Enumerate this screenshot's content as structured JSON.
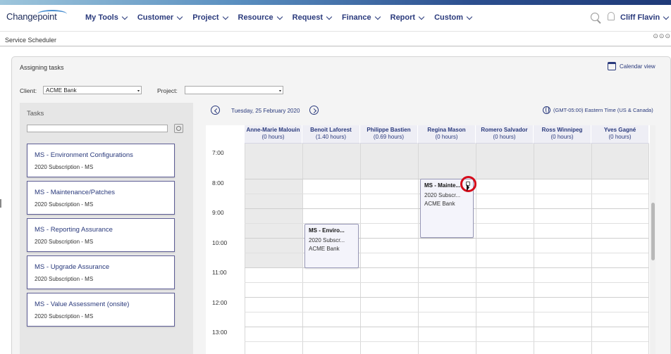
{
  "brand": {
    "logo": "Changepoint"
  },
  "nav": [
    {
      "label": "My Tools"
    },
    {
      "label": "Customer"
    },
    {
      "label": "Project"
    },
    {
      "label": "Resource"
    },
    {
      "label": "Request"
    },
    {
      "label": "Finance"
    },
    {
      "label": "Report"
    },
    {
      "label": "Custom"
    }
  ],
  "user": {
    "name": "Cliff Flavin"
  },
  "page": {
    "title": "Service Scheduler",
    "controls": "⊙⊙⊙"
  },
  "panel": {
    "title": "Assigning tasks",
    "calendar_view": "Calendar view"
  },
  "filters": {
    "client_label": "Client:",
    "client_value": "ACME Bank",
    "project_label": "Project:",
    "project_value": ""
  },
  "tasks": {
    "title": "Tasks",
    "search_value": "",
    "items": [
      {
        "name": "MS - Environment Configurations",
        "sub": "2020 Subscription - MS"
      },
      {
        "name": "MS - Maintenance/Patches",
        "sub": "2020 Subscription - MS"
      },
      {
        "name": "MS - Reporting Assurance",
        "sub": "2020 Subscription - MS"
      },
      {
        "name": "MS - Upgrade Assurance",
        "sub": "2020 Subscription - MS"
      },
      {
        "name": "MS - Value Assessment (onsite)",
        "sub": "2020 Subscription - MS"
      }
    ]
  },
  "schedule": {
    "date": "Tuesday, 25 February 2020",
    "timezone": "(GMT-05:00) Eastern Time (US & Canada)",
    "resources": [
      {
        "name": "Anne-Marie Malouin",
        "hours": "(0 hours)"
      },
      {
        "name": "Benoit Laforest",
        "hours": "(1.40 hours)"
      },
      {
        "name": "Philippe Bastien",
        "hours": "(0.69 hours)"
      },
      {
        "name": "Regina Mason",
        "hours": "(0 hours)"
      },
      {
        "name": "Romero Salvador",
        "hours": "(0 hours)"
      },
      {
        "name": "Ross Winnipeg",
        "hours": "(0 hours)"
      },
      {
        "name": "Yves Gagné",
        "hours": "(0 hours)"
      }
    ],
    "times": [
      "7:00",
      "8:00",
      "9:00",
      "10:00",
      "11:00",
      "12:00",
      "13:00"
    ],
    "appointments": [
      {
        "title": "MS - Enviro...",
        "line1": "2020 Subscr...",
        "line2": "ACME Bank"
      },
      {
        "title": "MS - Mainte...",
        "line1": "2020 Subscr...",
        "line2": "ACME Bank"
      }
    ]
  }
}
